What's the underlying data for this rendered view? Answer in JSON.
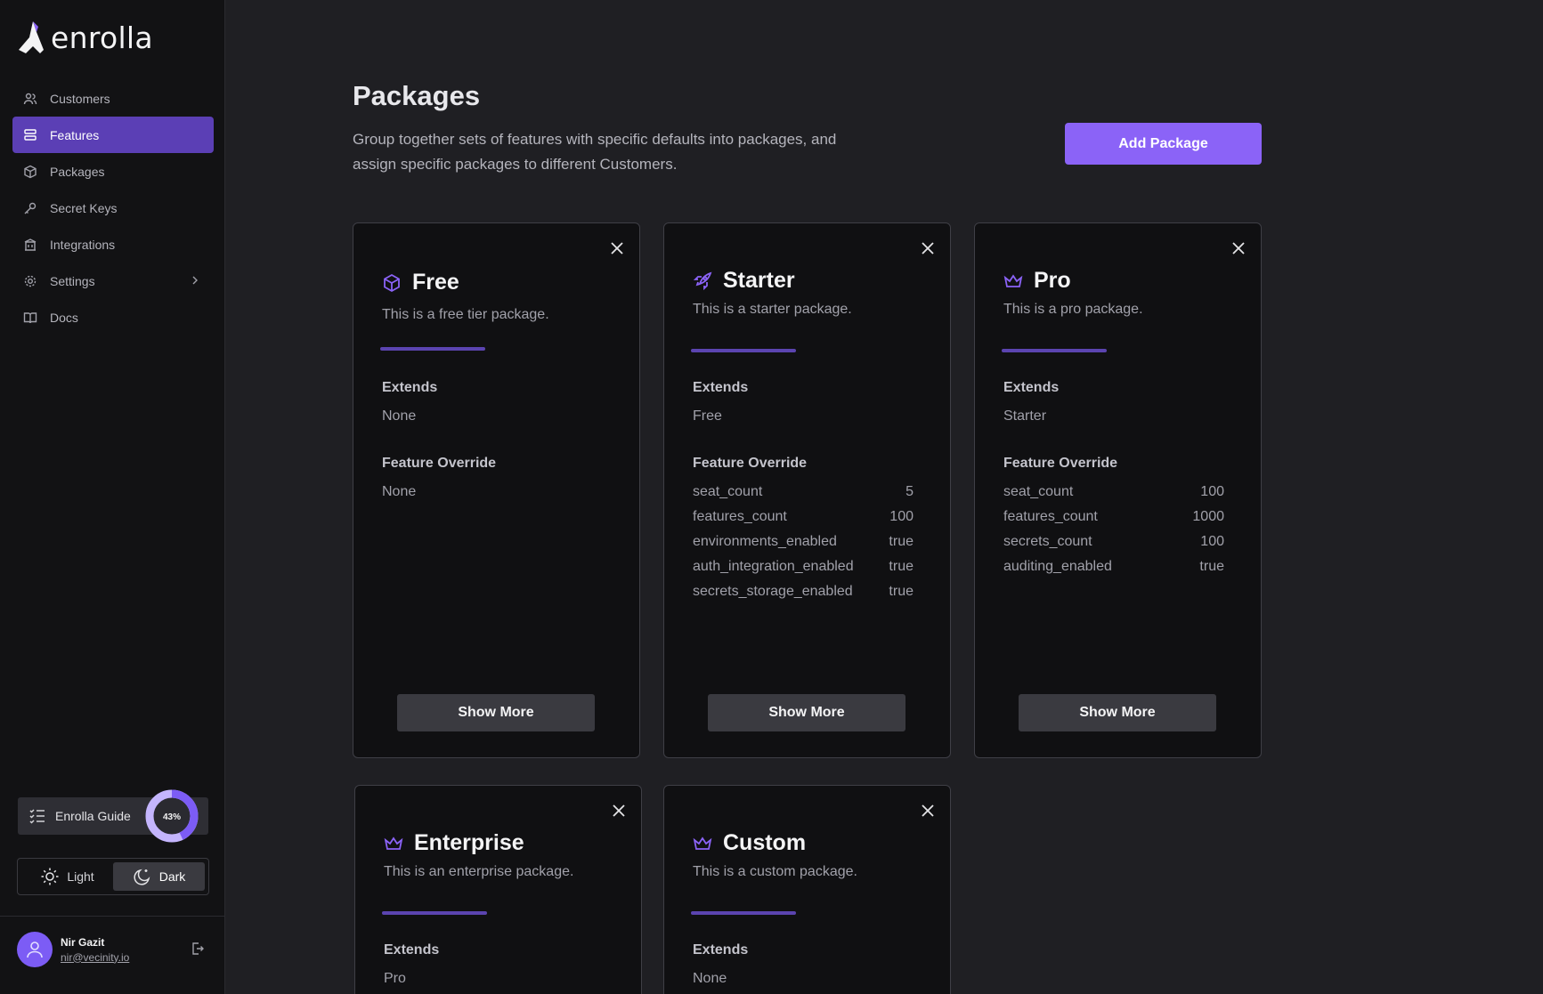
{
  "app": {
    "name": "enrolla"
  },
  "sidebar": {
    "items": [
      {
        "label": "Customers",
        "icon": "users-icon"
      },
      {
        "label": "Features",
        "icon": "list-icon"
      },
      {
        "label": "Packages",
        "icon": "package-icon"
      },
      {
        "label": "Secret Keys",
        "icon": "key-icon"
      },
      {
        "label": "Integrations",
        "icon": "building-icon"
      },
      {
        "label": "Settings",
        "icon": "gear-icon"
      },
      {
        "label": "Docs",
        "icon": "book-icon"
      }
    ],
    "active": "Features",
    "guide": {
      "label": "Enrolla Guide",
      "progress_label": "43%",
      "progress": 0.43
    },
    "theme": {
      "light": "Light",
      "dark": "Dark",
      "selected": "Dark"
    },
    "user": {
      "name": "Nir Gazit",
      "email": "nir@vecinity.io"
    }
  },
  "main": {
    "title": "Packages",
    "description": "Group together sets of features with specific defaults into packages, and assign specific packages to different Customers.",
    "add_button": "Add Package",
    "extends_label": "Extends",
    "override_label": "Feature Override",
    "show_more": "Show More",
    "packages": [
      {
        "name": "Free",
        "icon": "cube-icon",
        "description": "This is a free tier package.",
        "extends": "None",
        "overrides_text": "None",
        "overrides": []
      },
      {
        "name": "Starter",
        "icon": "rocket-icon",
        "description": "This is a starter package.",
        "extends": "Free",
        "overrides": [
          {
            "key": "seat_count",
            "value": "5"
          },
          {
            "key": "features_count",
            "value": "100"
          },
          {
            "key": "environments_enabled",
            "value": "true"
          },
          {
            "key": "auth_integration_enabled",
            "value": "true"
          },
          {
            "key": "secrets_storage_enabled",
            "value": "true"
          }
        ]
      },
      {
        "name": "Pro",
        "icon": "crown-icon",
        "description": "This is a pro package.",
        "extends": "Starter",
        "overrides": [
          {
            "key": "seat_count",
            "value": "100"
          },
          {
            "key": "features_count",
            "value": "1000"
          },
          {
            "key": "secrets_count",
            "value": "100"
          },
          {
            "key": "auditing_enabled",
            "value": "true"
          }
        ]
      },
      {
        "name": "Enterprise",
        "icon": "crown-icon",
        "description": "This is an enterprise package.",
        "extends": "Pro"
      },
      {
        "name": "Custom",
        "icon": "crown-icon",
        "description": "This is a custom package.",
        "extends": "None"
      }
    ]
  },
  "colors": {
    "accent": "#8b63f7",
    "active_nav": "#5b3fb5",
    "background": "#1f1f23",
    "card": "#101012"
  }
}
